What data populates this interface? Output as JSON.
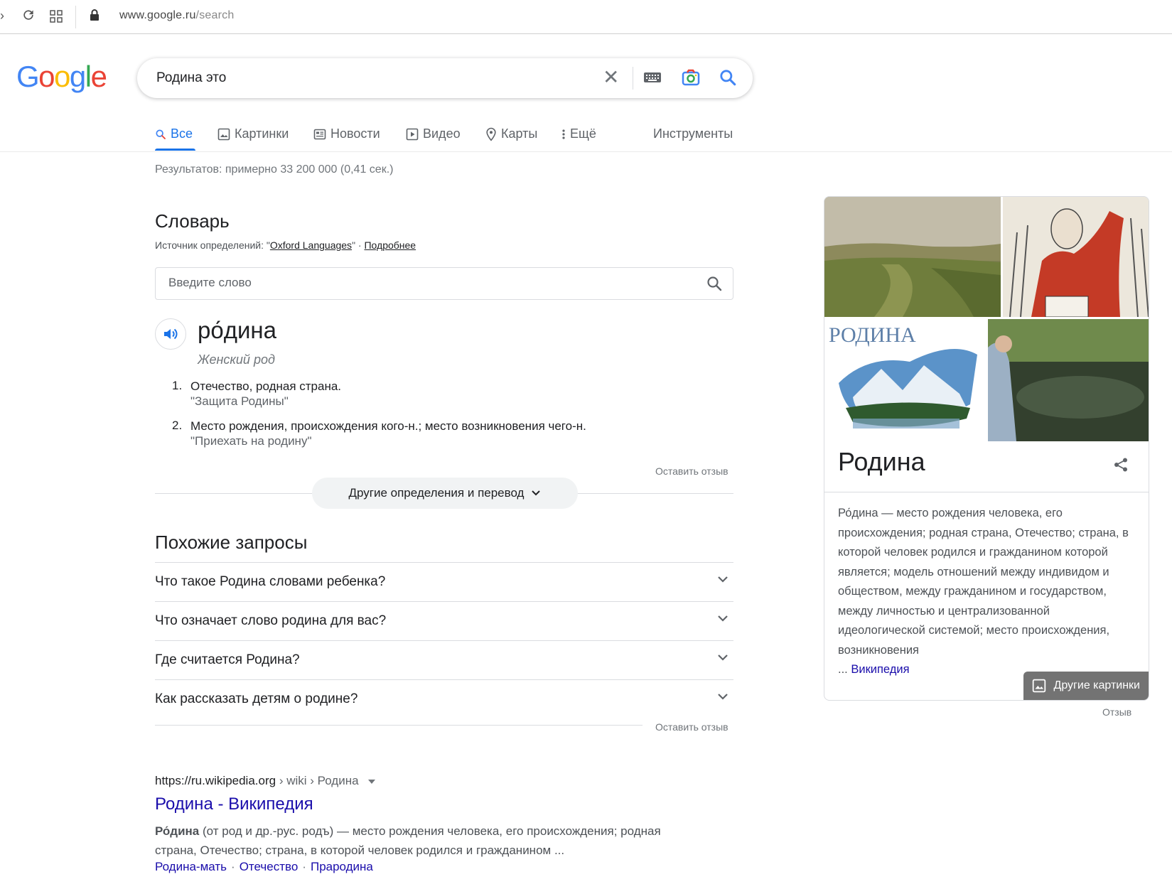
{
  "browser": {
    "url_host": "www.google.ru",
    "url_path": "/search"
  },
  "logo": {
    "letters": [
      "G",
      "o",
      "o",
      "g",
      "l",
      "e"
    ],
    "colors": [
      "#4285f4",
      "#ea4335",
      "#fbbc05",
      "#4285f4",
      "#34a853",
      "#ea4335"
    ]
  },
  "search": {
    "query": "Родина это"
  },
  "tabs": [
    {
      "label": "Все",
      "icon": "search-icon",
      "active": true
    },
    {
      "label": "Картинки",
      "icon": "image-icon"
    },
    {
      "label": "Новости",
      "icon": "news-icon"
    },
    {
      "label": "Видео",
      "icon": "video-icon"
    },
    {
      "label": "Карты",
      "icon": "map-pin-icon"
    },
    {
      "label": "Ещё",
      "icon": "more-vert-icon"
    }
  ],
  "tools_label": "Инструменты",
  "stats": "Результатов: примерно 33 200 000 (0,41 сек.)",
  "dictionary": {
    "title": "Словарь",
    "source_prefix": "Источник определений: \"",
    "source_link": "Oxford Languages",
    "source_suffix": "\" · ",
    "more_link": "Подробнее",
    "input_placeholder": "Введите слово",
    "word": "ро́дина",
    "gender": "Женский род",
    "definitions": [
      {
        "num": "1.",
        "text": "Отечество, родная страна.",
        "example": "\"Защита Родины\""
      },
      {
        "num": "2.",
        "text": "Место рождения, происхождения кого-н.; место возникновения чего-н.",
        "example": "\"Приехать на родину\""
      }
    ],
    "feedback": "Оставить отзыв",
    "more_button": "Другие определения и перевод"
  },
  "related": {
    "title": "Похожие запросы",
    "items": [
      "Что такое Родина словами ребенка?",
      "Что означает слово родина для вас?",
      "Где считается Родина?",
      "Как рассказать детям о родине?"
    ],
    "feedback": "Оставить отзыв"
  },
  "result": {
    "cite_host": "https://ru.wikipedia.org",
    "cite_path": " › wiki › Родина",
    "title": "Родина - Википедия",
    "snippet_bold": "Ро́дина",
    "snippet_rest": " (от род и др.-рус. родъ) — место рождения человека, его происхождения; родная страна, Отечество; страна, в которой человек родился и гражданином ...",
    "links": [
      "Родина-мать",
      "Отечество",
      "Прародина"
    ]
  },
  "knowledge_panel": {
    "image3_text": "РОДИНА",
    "more_images": "Другие картинки",
    "title": "Родина",
    "description": "Ро́дина — место рождения человека, его происхождения; родная страна, Отечество; страна, в которой человек родился и гражданином которой является; модель отношений между индивидом и обществом, между гражданином и государством, между личностью и централизованной идеологической системой; место происхождения, возникновения",
    "desc_ellipsis": "... ",
    "source_link": "Википедия",
    "feedback": "Отзыв"
  }
}
